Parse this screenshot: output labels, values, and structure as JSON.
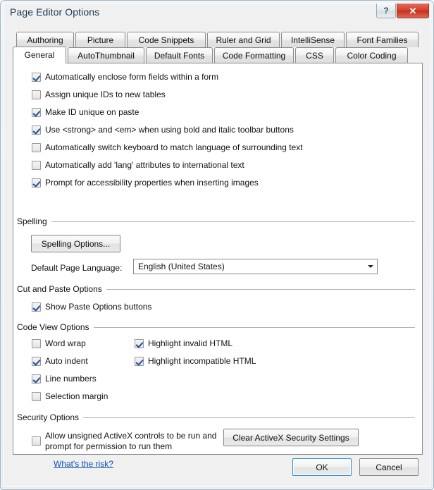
{
  "window": {
    "title": "Page Editor Options",
    "help_glyph": "?",
    "close_glyph": "✕"
  },
  "tabs": {
    "row1": [
      {
        "label": "Authoring",
        "selected": false
      },
      {
        "label": "Picture",
        "selected": false
      },
      {
        "label": "Code Snippets",
        "selected": false
      },
      {
        "label": "Ruler and Grid",
        "selected": false
      },
      {
        "label": "IntelliSense",
        "selected": false
      },
      {
        "label": "Font Families",
        "selected": false
      }
    ],
    "row2": [
      {
        "label": "General",
        "selected": true
      },
      {
        "label": "AutoThumbnail",
        "selected": false
      },
      {
        "label": "Default Fonts",
        "selected": false
      },
      {
        "label": "Code Formatting",
        "selected": false
      },
      {
        "label": "CSS",
        "selected": false
      },
      {
        "label": "Color Coding",
        "selected": false
      }
    ]
  },
  "general_options": [
    {
      "label": "Automatically enclose form fields within a form",
      "checked": true
    },
    {
      "label": "Assign unique IDs to new tables",
      "checked": false
    },
    {
      "label": "Make ID unique on paste",
      "checked": true
    },
    {
      "label": "Use <strong> and <em> when using bold and italic toolbar buttons",
      "checked": true
    },
    {
      "label": "Automatically switch keyboard to match language of surrounding text",
      "checked": false
    },
    {
      "label": "Automatically add 'lang' attributes to international text",
      "checked": false
    },
    {
      "label": "Prompt for accessibility properties when inserting images",
      "checked": true
    }
  ],
  "spelling": {
    "group_label": "Spelling",
    "options_button": "Spelling Options...",
    "language_label": "Default Page Language:",
    "language_value": "English (United States)"
  },
  "cut_and_paste": {
    "group_label": "Cut and Paste Options",
    "show_paste_options": {
      "label": "Show Paste Options buttons",
      "checked": true
    }
  },
  "code_view": {
    "group_label": "Code View Options",
    "left_column": [
      {
        "label": "Word wrap",
        "checked": false
      },
      {
        "label": "Auto indent",
        "checked": true
      },
      {
        "label": "Line numbers",
        "checked": true
      },
      {
        "label": "Selection margin",
        "checked": false
      }
    ],
    "right_column": [
      {
        "label": "Highlight invalid HTML",
        "checked": true
      },
      {
        "label": "Highlight incompatible HTML",
        "checked": true
      }
    ]
  },
  "security": {
    "group_label": "Security Options",
    "activex_checkbox": {
      "label": "Allow unsigned ActiveX controls to be run and prompt for permission to run them",
      "checked": false
    },
    "clear_button": "Clear ActiveX Security Settings",
    "risk_link": "What's the risk?"
  },
  "footer": {
    "ok": "OK",
    "cancel": "Cancel"
  },
  "colors": {
    "accent": "#2a8fd4",
    "link": "#0b50b4",
    "close_red": "#d4402c",
    "check_blue": "#1a4fa0",
    "title_text": "#1b3a55"
  }
}
